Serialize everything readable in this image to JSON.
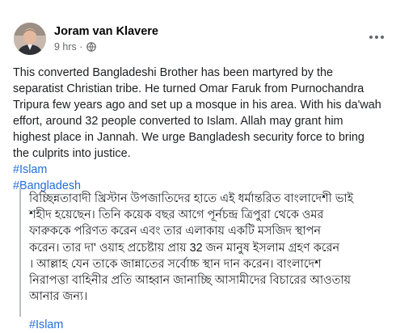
{
  "post": {
    "author": "Joram van Klavere",
    "time": "9 hrs ·",
    "privacy_icon": "globe-icon",
    "more_icon": "more-options-icon",
    "text": "This converted Bangladeshi Brother has been martyred by the\nseparatist Christian tribe. He turned Omar Faruk from Purnochandra\nTripura few years ago and set up a mosque in his area. With his da'wah\neffort, around 32 people converted to Islam. Allah may grant him\nhighest place in Jannah. We urge Bangladesh security force to bring\nthe culprits into justice.",
    "hashtags": [
      "#Islam",
      "#Bangladesh"
    ],
    "quoted": {
      "text": "বিচ্ছিন্নতাবাদী খ্রিস্টান উপজাতিদের হাতে এই ধর্মান্তরিত বাংলাদেশী ভাই\nশহীদ হয়েছেন। তিনি কয়েক বছর আগে পূর্নচন্দ্র ত্রিপুরা থেকে ওমর\nফারুককে পরিণত করেন এবং তার এলাকায় একটি মসজিদ স্থাপন\nকরেন। তার দা' ওয়াহ প্রচেষ্টায় প্রায় 32 জন মানুষ ইসলাম গ্রহণ করেন\n। আল্লাহ যেন তাকে জান্নাতের সর্বোচ্চ স্থান দান করেন। বাংলাদেশ\nনিরাপত্তা বাহিনীর প্রতি আহ্বান জানাচ্ছি আসামীদের বিচারের আওতায়\nআনার জন্য।",
      "hashtag": "#Islam"
    }
  },
  "colors": {
    "link": "#216fdb",
    "secondary_text": "#65676b",
    "quote_border": "#bcc0c4"
  }
}
